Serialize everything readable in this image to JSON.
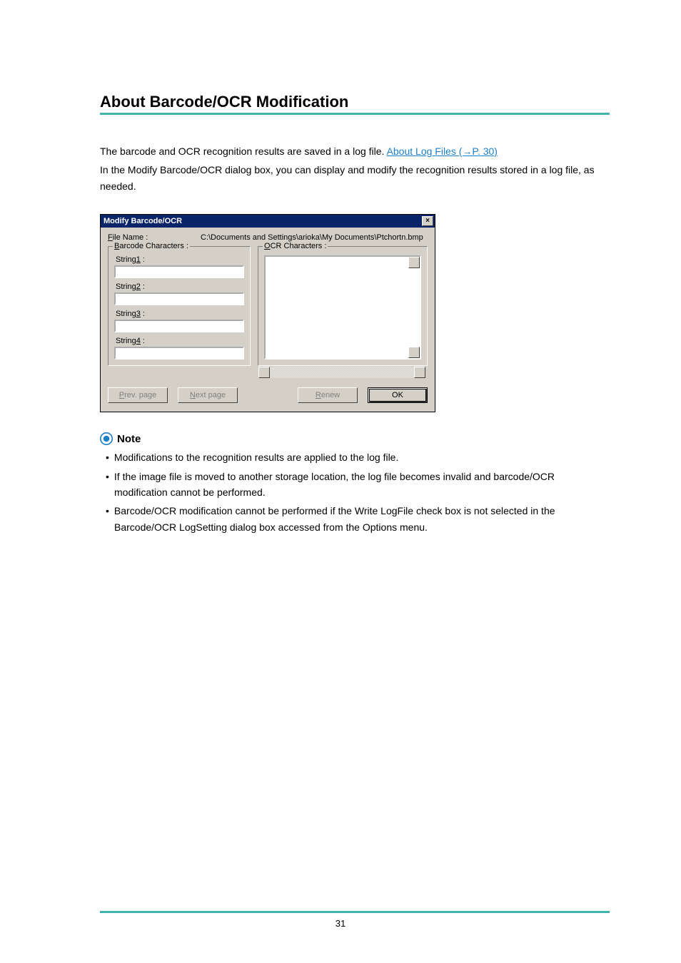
{
  "heading": "About Barcode/OCR Modification",
  "intro": {
    "line1_prefix": "The barcode and OCR recognition results are saved in a log file. ",
    "link": "About Log Files (→P. 30)",
    "line2": "In the Modify Barcode/OCR dialog box, you can display and modify the recognition results stored in a log file, as needed."
  },
  "dialog": {
    "title": "Modify Barcode/OCR",
    "close_label": "×",
    "filename_label_pre": "F",
    "filename_label": "ile Name :",
    "filename_value": "C:\\Documents and Settings\\arioka\\My Documents\\Ptchortn.bmp",
    "barcode_legend_pre": "B",
    "barcode_legend": "arcode Characters :",
    "ocr_legend_pre": "O",
    "ocr_legend": "CR Characters :",
    "string1_pre": "String",
    "string1_u": "1",
    "string1_suf": " :",
    "string2_pre": "String",
    "string2_u": "2",
    "string2_suf": " :",
    "string3_pre": "String",
    "string3_u": "3",
    "string3_suf": " :",
    "string4_pre": "String",
    "string4_u": "4",
    "string4_suf": " :",
    "string1_val": "",
    "string2_val": "",
    "string3_val": "",
    "string4_val": "",
    "prev_u": "P",
    "prev": "rev. page",
    "next_u": "N",
    "next": "ext page",
    "renew_u": "R",
    "renew": "enew",
    "ok": "OK"
  },
  "note": {
    "title": "Note",
    "items": [
      "Modifications to the recognition results are applied to the log file.",
      "If the image file is moved to another storage location, the log file becomes invalid and barcode/OCR modification cannot be performed.",
      "Barcode/OCR modification cannot be performed if the Write LogFile check box is not selected in the Barcode/OCR LogSetting dialog box accessed from the Options menu."
    ]
  },
  "page_number": "31"
}
